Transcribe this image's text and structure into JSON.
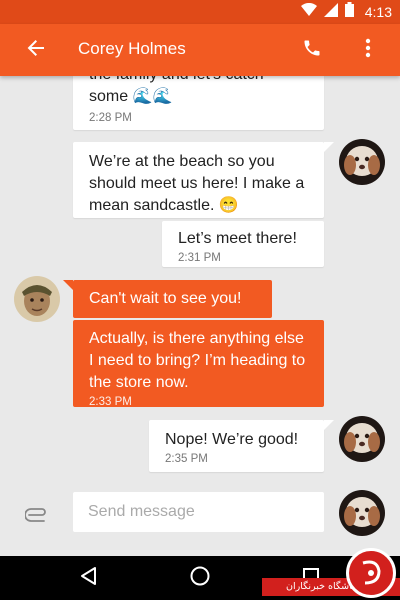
{
  "status_bar": {
    "time": "4:13"
  },
  "app_bar": {
    "title": "Corey Holmes"
  },
  "messages": [
    {
      "direction": "outgoing",
      "text_line1": "the family and let's catch",
      "text_line2": "some 🌊🌊",
      "time": "2:28 PM"
    },
    {
      "direction": "outgoing",
      "text": "We’re at the beach so you should meet us here! I make a mean sandcastle. 😁"
    },
    {
      "direction": "outgoing",
      "text": "Let’s meet there!",
      "time": "2:31 PM"
    },
    {
      "direction": "incoming",
      "text": "Can't wait to see you!"
    },
    {
      "direction": "incoming",
      "text": "Actually, is there anything else I need to bring? I’m heading to the store now.",
      "time": "2:33 PM"
    },
    {
      "direction": "outgoing",
      "text": "Nope! We’re good!",
      "time": "2:35 PM"
    }
  ],
  "compose": {
    "placeholder": "Send message"
  },
  "watermark": {
    "text": "باشگاه خبرنگاران"
  },
  "colors": {
    "primary": "#f25a22",
    "primary_dark": "#e04a18",
    "background": "#e9e9e9",
    "outgoing_bubble": "#ffffff",
    "incoming_bubble": "#f25a22"
  },
  "icons": {
    "back": "arrow-back-icon",
    "call": "phone-icon",
    "more": "more-vert-icon",
    "attach": "paperclip-icon",
    "nav_back": "triangle-back-icon",
    "nav_home": "circle-home-icon",
    "nav_recents": "square-recents-icon"
  }
}
